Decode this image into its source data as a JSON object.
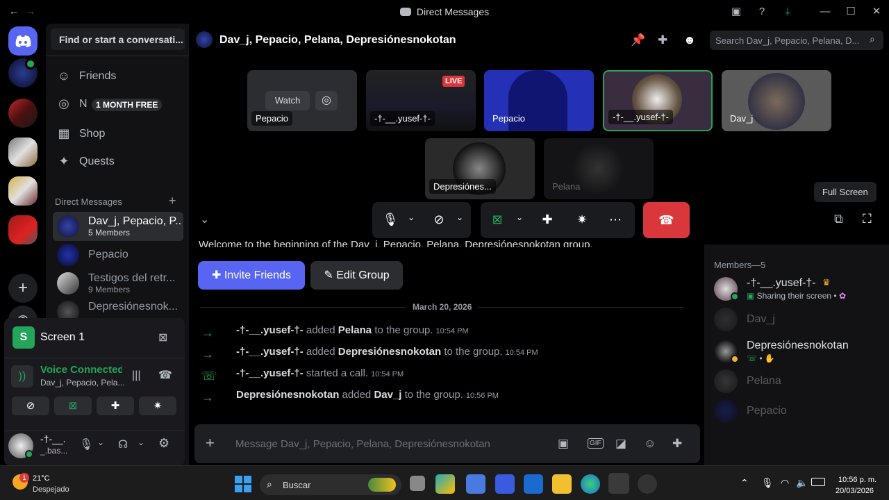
{
  "window": {
    "title": "Direct Messages"
  },
  "sidebar": {
    "search_placeholder": "Find or start a conversati...",
    "nav": [
      {
        "label": "Friends",
        "icon": "friends-icon"
      },
      {
        "label": "N",
        "icon": "nitro-icon",
        "badge": "1 MONTH FREE"
      },
      {
        "label": "Shop",
        "icon": "shop-icon"
      },
      {
        "label": "Quests",
        "icon": "quests-icon"
      }
    ],
    "dm_header": "Direct Messages",
    "dms": [
      {
        "name": "Dav_j, Pepacio, P...",
        "sub": "5 Members"
      },
      {
        "name": "Pepacio",
        "sub": ""
      },
      {
        "name": "Testigos del retr...",
        "sub": "9 Members"
      },
      {
        "name": "Depresiónesnok...",
        "sub": ""
      }
    ]
  },
  "screen_panel": {
    "title": "Screen 1",
    "voice_status": "Voice Connected",
    "voice_channel": "Dav_j, Pepacio, Pela..."
  },
  "user": {
    "name": "-†-__.",
    "status": "_.bas..."
  },
  "header": {
    "title": "Dav_j, Pepacio, Pelana, Depresiónesnokotan",
    "search_placeholder": "Search Dav_j, Pepacio, Pelana, D..."
  },
  "call": {
    "tiles": [
      {
        "label": "Pepacio",
        "watch": "Watch"
      },
      {
        "label": "-†-__.yusef-†-",
        "live": "LIVE"
      },
      {
        "label": "Pepacio"
      },
      {
        "label": "-†-__.yusef-†-"
      },
      {
        "label": "Dav_j"
      },
      {
        "label": "Depresiónes..."
      },
      {
        "label": "Pelana"
      }
    ],
    "tooltip": "Full Screen"
  },
  "chat": {
    "welcome": "Welcome to the beginning of the Dav_j, Pepacio, Pelana, Depresiónesnokotan group.",
    "invite_label": "Invite Friends",
    "edit_label": "Edit Group",
    "date": "March 20, 2026",
    "messages": [
      {
        "actor": "-†-__.yusef-†-",
        "action": "added",
        "target": "Pelana",
        "rest": "to the group.",
        "time": "10:54 PM"
      },
      {
        "actor": "-†-__.yusef-†-",
        "action": "added",
        "target": "Depresiónesnokotan",
        "rest": "to the group.",
        "time": "10:54 PM"
      },
      {
        "actor": "-†-__.yusef-†-",
        "action": "started a call.",
        "target": "",
        "rest": "",
        "time": "10:54 PM"
      },
      {
        "actor": "Depresiónesnokotan",
        "action": "added",
        "target": "Dav_j",
        "rest": "to the group.",
        "time": "10:56 PM"
      }
    ],
    "input_placeholder": "Message Dav_j, Pepacio, Pelana, Depresiónesnokotan"
  },
  "members": {
    "header": "Members—5",
    "list": [
      {
        "name": "-†-__.yusef-†-",
        "status": "Sharing their screen • "
      },
      {
        "name": "Dav_j",
        "status": ""
      },
      {
        "name": "Depresiónesnokotan",
        "status": "•"
      },
      {
        "name": "Pelana",
        "status": ""
      },
      {
        "name": "Pepacio",
        "status": ""
      }
    ]
  },
  "taskbar": {
    "weather_temp": "21°C",
    "weather_desc": "Despejado",
    "weather_badge": "1",
    "search": "Buscar",
    "time": "10:56 p. m.",
    "date": "20/03/2026"
  },
  "colors": {
    "accent": "#5865f2",
    "green": "#23a55a",
    "red": "#da373c"
  }
}
